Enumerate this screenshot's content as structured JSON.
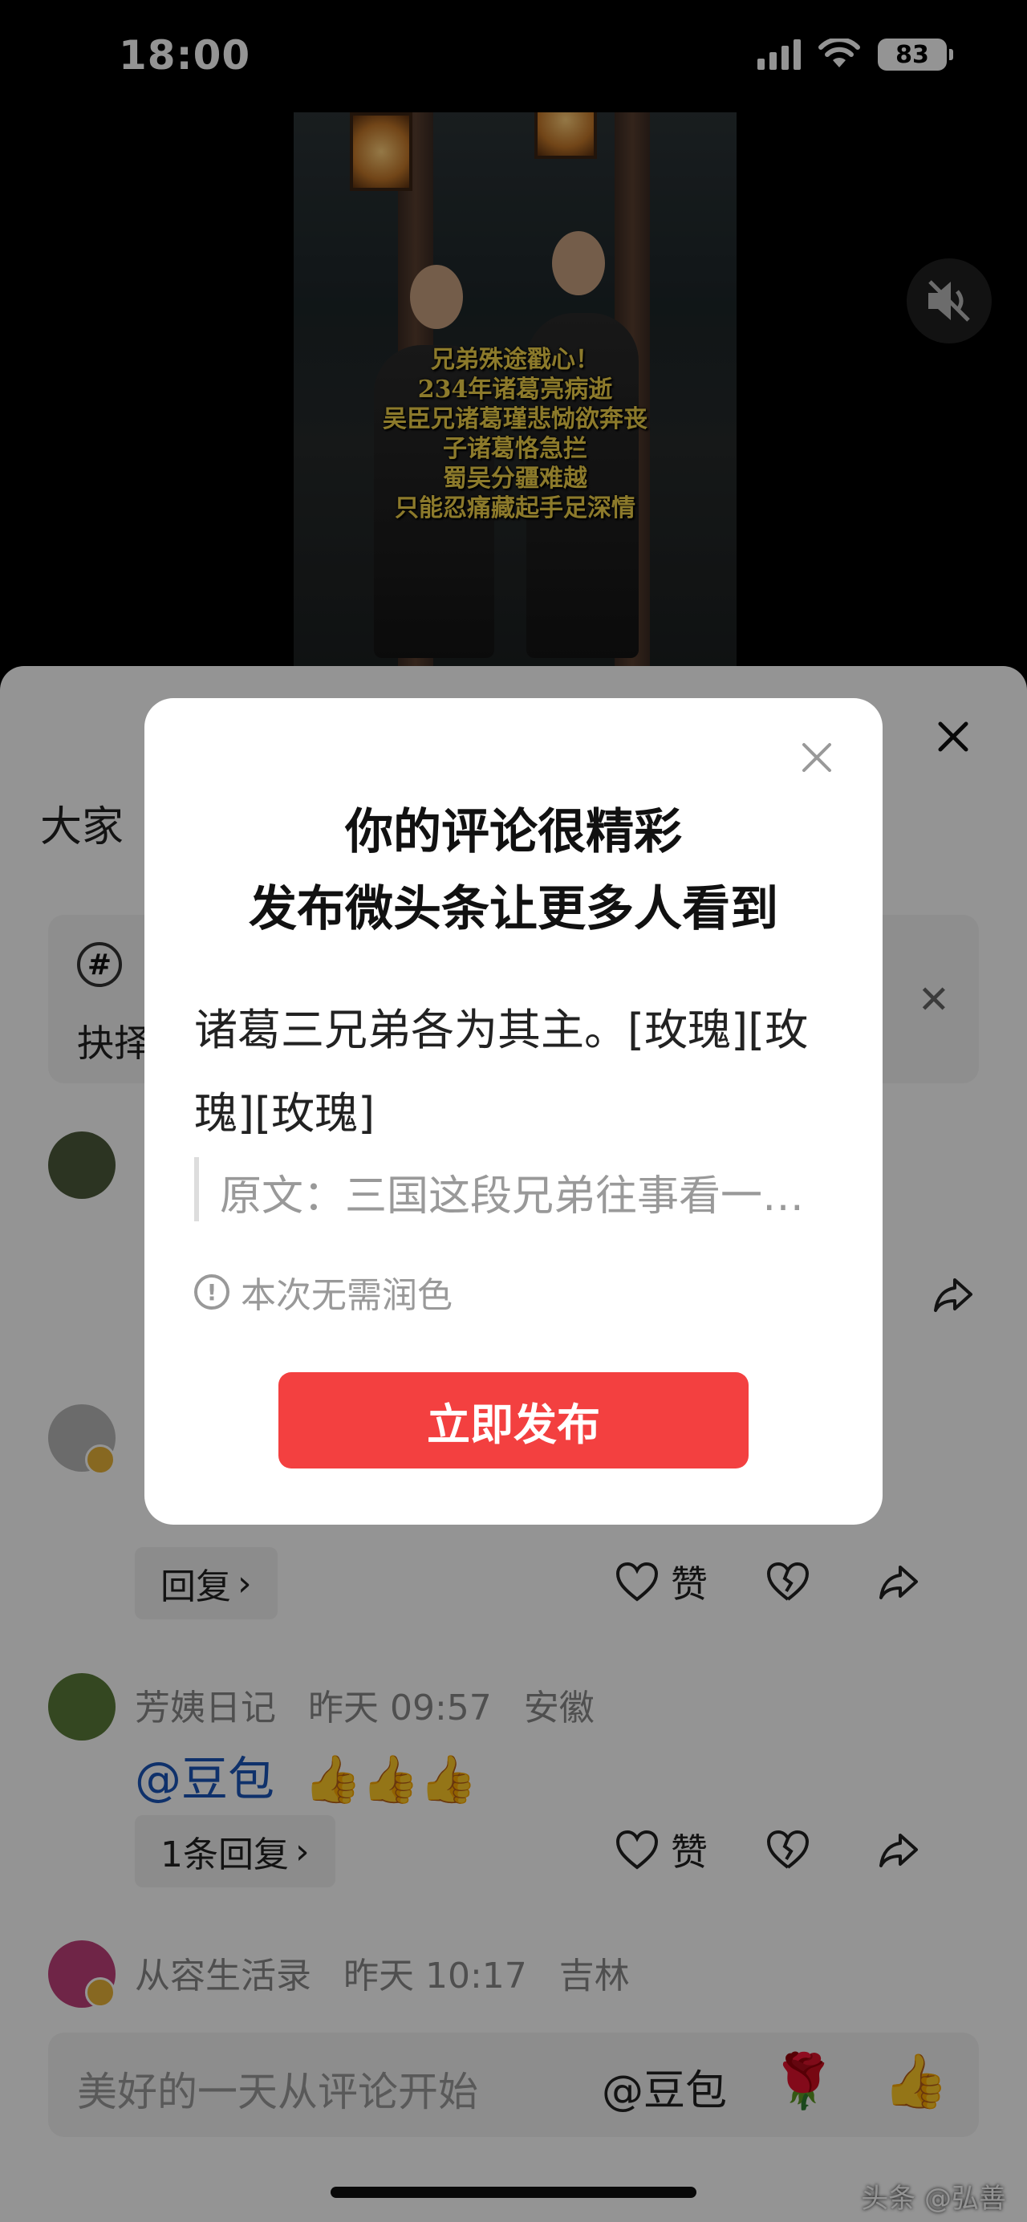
{
  "status_bar": {
    "time": "18:00",
    "battery": "83"
  },
  "video": {
    "caption_lines": [
      "兄弟殊途戳心！",
      "234年诸葛亮病逝",
      "吴臣兄诸葛瑾悲恸欲奔丧",
      "子诸葛恪急拦",
      "蜀吴分疆难越",
      "只能忍痛藏起手足深情"
    ]
  },
  "sheet": {
    "title_partial": "大家",
    "tip_text_partial": "抉择"
  },
  "comments": [
    {
      "reply": "回复",
      "like": "赞"
    },
    {
      "author": "芳姨日记",
      "time": "昨天 09:57",
      "location": "安徽",
      "mention": "@豆包",
      "text": "👍👍👍",
      "reply": "1条回复",
      "like": "赞"
    },
    {
      "author": "从容生活录",
      "time": "昨天 10:17",
      "location": "吉林"
    }
  ],
  "input": {
    "placeholder": "美好的一天从评论开始",
    "mention": "@豆包",
    "emoji_1": "🌹",
    "emoji_2": "👍"
  },
  "dialog": {
    "title_line1": "你的评论很精彩",
    "title_line2": "发布微头条让更多人看到",
    "body": "诸葛三兄弟各为其主。[玫瑰][玫瑰][玫瑰]",
    "quote": "原文：三国这段兄弟往事看一…",
    "note": "本次无需润色",
    "publish_label": "立即发布"
  },
  "watermark": "头条 @弘善",
  "colors": {
    "publish_button": "#f34040",
    "mention": "#1a55b8",
    "caption": "#f2d24a"
  }
}
